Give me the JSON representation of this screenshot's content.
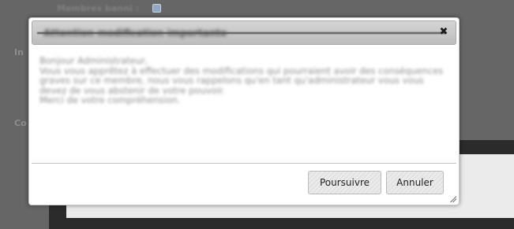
{
  "background": {
    "header_label": "Membres banni :",
    "sidebar_fragments": [
      "In",
      "Co"
    ]
  },
  "dialog": {
    "title": "Attention modification importante",
    "body": [
      "Bonjour Administrateur,",
      "Vous vous apprêtez à effectuer des modifications qui pourraient avoir des conséquences",
      "graves sur ce membre, nous vous rappelons qu'en tant qu'administrateur vous vous",
      "devez de vous abstenir de votre pouvoir.",
      "Merci de votre compréhension."
    ],
    "buttons": {
      "continue": "Poursuivre",
      "cancel": "Annuler"
    }
  }
}
